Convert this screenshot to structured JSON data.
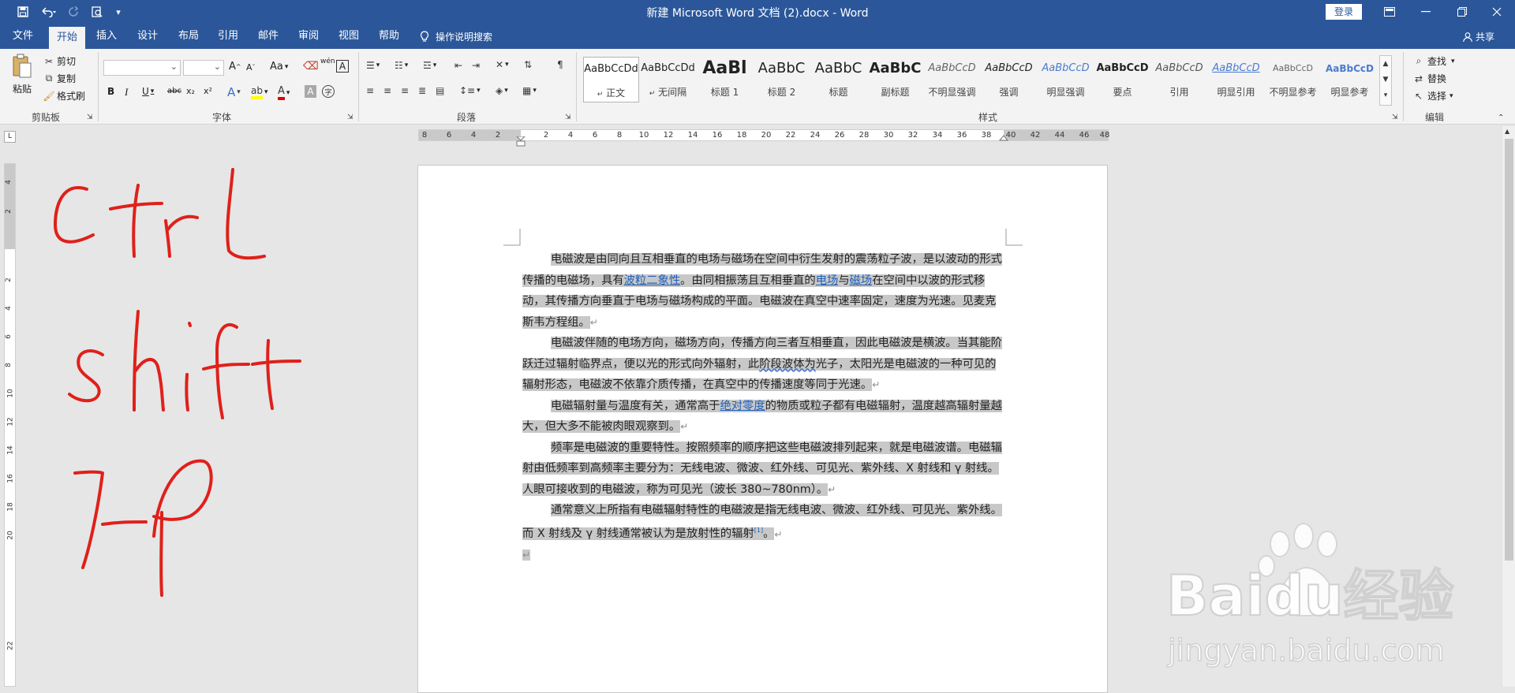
{
  "titlebar": {
    "title": "新建 Microsoft Word 文档 (2).docx  -  Word",
    "login_label": "登录",
    "qat_customize": "▾"
  },
  "tabs": [
    "文件",
    "开始",
    "插入",
    "设计",
    "布局",
    "引用",
    "邮件",
    "审阅",
    "视图",
    "帮助"
  ],
  "active_tab": "开始",
  "tell_me": "操作说明搜索",
  "share_label": "共享",
  "ribbon": {
    "clipboard": {
      "label": "剪贴板",
      "paste": "粘贴",
      "cut": "剪切",
      "copy": "复制",
      "format_painter": "格式刷"
    },
    "font": {
      "label": "字体",
      "grow": "A",
      "shrink": "A",
      "case": "Aa",
      "bold": "B",
      "italic": "I",
      "underline": "U",
      "strike": "abc",
      "sub": "x₂",
      "sup": "x²",
      "pinyin": "wén",
      "border_char": "A"
    },
    "paragraph": {
      "label": "段落"
    },
    "styles": {
      "label": "样式",
      "items": [
        {
          "preview": "AaBbCcDd",
          "name": "正文"
        },
        {
          "preview": "AaBbCcDd",
          "name": "无间隔"
        },
        {
          "preview": "AaBl",
          "name": "标题 1"
        },
        {
          "preview": "AaBbC",
          "name": "标题 2"
        },
        {
          "preview": "AaBbC",
          "name": "标题"
        },
        {
          "preview": "AaBbC",
          "name": "副标题"
        },
        {
          "preview": "AaBbCcD",
          "name": "不明显强调"
        },
        {
          "preview": "AaBbCcD",
          "name": "强调"
        },
        {
          "preview": "AaBbCcD",
          "name": "明显强调"
        },
        {
          "preview": "AaBbCcD",
          "name": "要点"
        },
        {
          "preview": "AaBbCcD",
          "name": "引用"
        },
        {
          "preview": "AaBbCcD",
          "name": "明显引用"
        },
        {
          "preview": "AaBbCcD",
          "name": "不明显参考"
        },
        {
          "preview": "AaBbCcD",
          "name": "明显参考"
        }
      ]
    },
    "editing": {
      "label": "编辑",
      "find": "查找",
      "replace": "替换",
      "select": "选择"
    }
  },
  "ruler": {
    "left_numbers": [
      "8",
      "6",
      "4",
      "2"
    ],
    "right_numbers": [
      "2",
      "4",
      "6",
      "8",
      "10",
      "12",
      "14",
      "16",
      "18",
      "20",
      "22",
      "24",
      "26",
      "28",
      "30",
      "32",
      "34",
      "36",
      "38",
      "40",
      "42",
      "44",
      "46",
      "48"
    ],
    "vertical_numbers": [
      "4",
      "2",
      "2",
      "4",
      "6",
      "8",
      "10",
      "12",
      "14",
      "16",
      "18",
      "20",
      "22"
    ],
    "corner": "L"
  },
  "document": {
    "p1": {
      "a": "电磁波是由同向且互相垂直的电场与磁场在空间中衍生发射的震荡粒子波，是以波动的形式传播的电磁场，具有",
      "link1": "波粒二象性",
      "b": "。由同相振荡且互相垂直的",
      "link2": "电场",
      "c": "与",
      "link3": "磁场",
      "d": "在空间中以波的形式移动，其传播方向垂直于电场与磁场构成的平面。电磁波在真空中速率固定，速度为光速。见麦克斯韦方程组。"
    },
    "p2": {
      "a": "电磁波伴随的电场方向，磁场方向，传播方向三者互相垂直，因此电磁波是横波。当其能阶跃迁过辐射临界点，便以光的形式向外辐射，此",
      "wavy": "阶段波体为",
      "b": "光子，太阳光是电磁波的一种可见的辐射形态，电磁波不依靠介质传播，在真空中的传播速度等同于光速。"
    },
    "p3": {
      "a": "电磁辐射量与温度有关，通常高于",
      "link": "绝对零度",
      "b": "的物质或粒子都有电磁辐射，温度越高辐射量越大，但大多不能被肉眼观察到。"
    },
    "p4": "频率是电磁波的重要特性。按照频率的顺序把这些电磁波排列起来，就是电磁波谱。电磁辐射由低频率到高频率主要分为：无线电波、微波、红外线、可见光、紫外线、X 射线和 γ 射线。人眼可接收到的电磁波，称为可见光（波长 380~780nm）。",
    "p5": {
      "a": "通常意义上所指有电磁辐射特性的电磁波是指无线电波、微波、红外线、可见光、紫外线。而 X 射线及 γ 射线通常被认为是放射性的辐射",
      "ref": "[1]",
      "b": "。"
    },
    "pilcrow": "↵"
  },
  "annotation": {
    "line1": "Ctrl",
    "line2": "shift",
    "line3": "J-P"
  },
  "watermark": {
    "brand": "Baidu经验",
    "url": "jingyan.baidu.com"
  },
  "colors": {
    "brand": "#2b579a",
    "ink": "#e0201a",
    "selection": "#c8c8c8",
    "link": "#1f5fb8"
  }
}
